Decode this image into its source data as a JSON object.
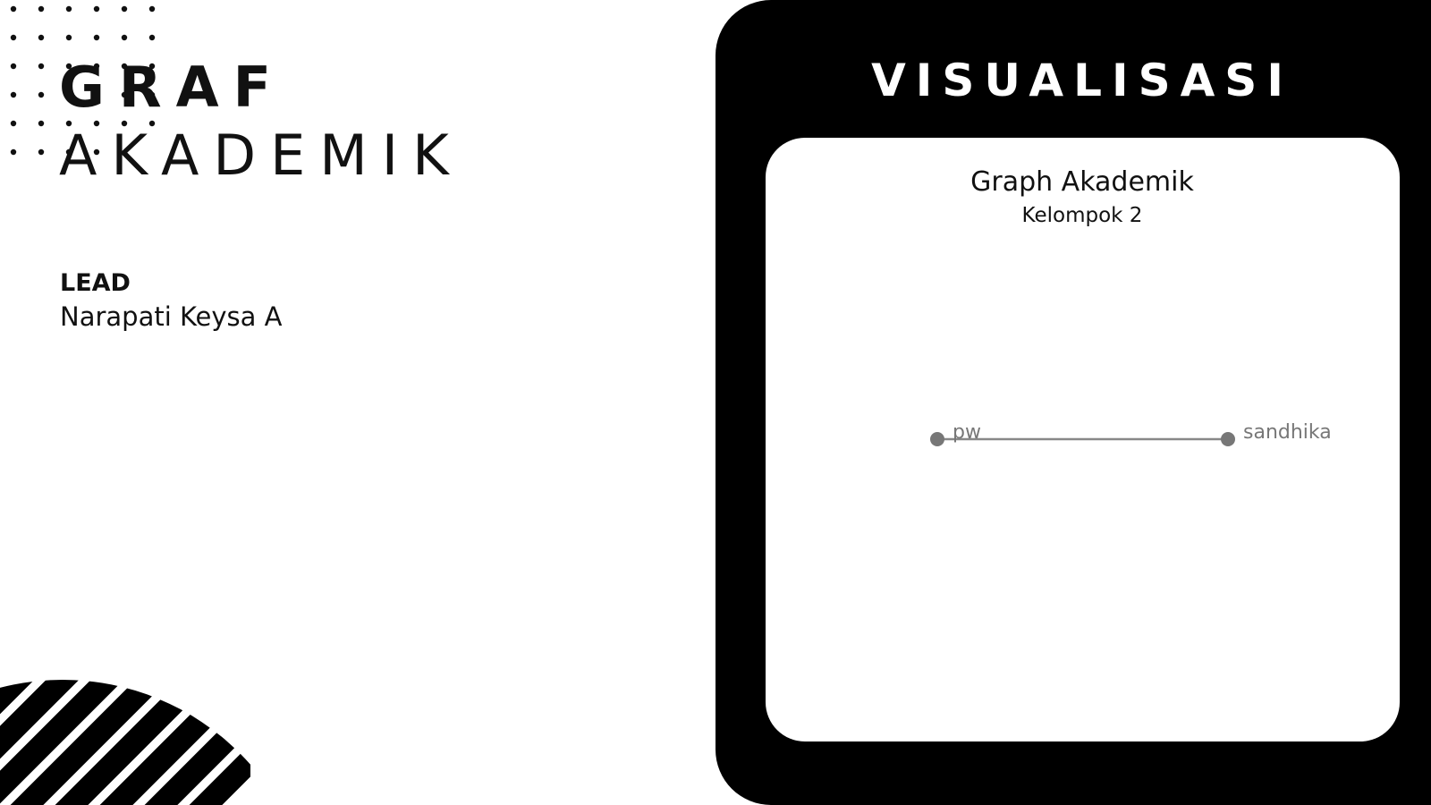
{
  "title": {
    "line1": "GRAF",
    "line2": "AKADEMIK"
  },
  "lead": {
    "label": "LEAD",
    "name": "Narapati Keysa A"
  },
  "panel": {
    "heading": "VISUALISASI"
  },
  "graph": {
    "title": "Graph Akademik",
    "subtitle": "Kelompok 2",
    "nodes": [
      {
        "id": "pw",
        "label": "pw"
      },
      {
        "id": "sandhika",
        "label": "sandhika"
      }
    ],
    "edges": [
      {
        "source": "pw",
        "target": "sandhika"
      }
    ],
    "colors": {
      "node": "#777777",
      "edge": "#888888",
      "label": "#777777"
    }
  },
  "theme": {
    "panel_background": "#000000",
    "card_background": "#ffffff",
    "text": "#111111"
  }
}
